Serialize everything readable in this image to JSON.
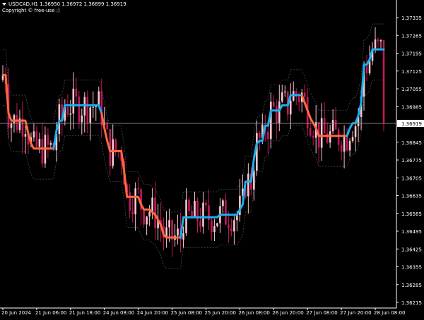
{
  "header": {
    "symbol_line": "USDCAD,H1  1.36950 1.36972 1.36899 1.36919",
    "copyright": "Copyright © free-use :)"
  },
  "chart_data": {
    "type": "candlestick",
    "symbol": "USDCAD",
    "timeframe": "H1",
    "ohlc_header": {
      "open": 1.3695,
      "high": 1.36972,
      "low": 1.36899,
      "close": 1.36919
    },
    "current_price": 1.36919,
    "ylim": [
      1.3618,
      1.374
    ],
    "y_ticks": [
      1.37335,
      1.37265,
      1.37195,
      1.37125,
      1.37055,
      1.36985,
      1.36915,
      1.36845,
      1.36775,
      1.36705,
      1.36635,
      1.36565,
      1.36495,
      1.36425,
      1.36355,
      1.36285,
      1.36215
    ],
    "y_tick_labels": [
      "1.37335",
      "1.37265",
      "1.37195",
      "1.37125",
      "1.37055",
      "1.36985",
      "1.36919",
      "1.36845",
      "1.36775",
      "1.36705",
      "1.36635",
      "1.36565",
      "1.36495",
      "1.36425",
      "1.36355",
      "1.36285",
      "1.36215"
    ],
    "x_tick_labels": [
      "20 Jun 2024",
      "21 Jun 06:00",
      "21 Jun 18:00",
      "24 Jun 08:00",
      "24 Jun 20:00",
      "25 Jun 08:00",
      "25 Jun 20:00",
      "26 Jun 08:00",
      "26 Jun 20:00",
      "27 Jun 08:00",
      "27 Jun 20:00",
      "28 Jun 08:00"
    ],
    "x_tick_index": [
      0,
      12,
      24,
      36,
      48,
      60,
      72,
      84,
      96,
      108,
      120,
      132
    ],
    "bar_count": 136,
    "grid": false,
    "colors": {
      "background": "#000000",
      "axis_text": "#ffffff",
      "bull_candle": "#f7c6cc",
      "bear_candle": "#c2185b",
      "trend_up": "#1ab0f0",
      "trend_down": "#ff6a3d",
      "channel": "#555555",
      "price_line": "#8a8a8a"
    },
    "trend_line": {
      "name": "",
      "segments": [
        {
          "direction": "down",
          "start": 0,
          "end": 18
        },
        {
          "direction": "up",
          "start": 18,
          "end": 35
        },
        {
          "direction": "down",
          "start": 35,
          "end": 63
        },
        {
          "direction": "up",
          "start": 63,
          "end": 106
        },
        {
          "direction": "down",
          "start": 106,
          "end": 122
        },
        {
          "direction": "up",
          "start": 122,
          "end": 135
        }
      ],
      "values": [
        1.3711,
        1.3711,
        1.3696,
        1.3693,
        1.3693,
        1.3693,
        1.3693,
        1.3693,
        1.3693,
        1.3688,
        1.3684,
        1.3682,
        1.3682,
        1.3682,
        1.3682,
        1.3682,
        1.3682,
        1.3682,
        1.3682,
        1.3689,
        1.3693,
        1.3693,
        1.3699,
        1.3699,
        1.3699,
        1.3699,
        1.3699,
        1.3699,
        1.3699,
        1.3699,
        1.3699,
        1.3699,
        1.3699,
        1.3699,
        1.3699,
        1.3696,
        1.369,
        1.3685,
        1.3681,
        1.3681,
        1.3681,
        1.3681,
        1.3681,
        1.3673,
        1.3663,
        1.3663,
        1.3663,
        1.3663,
        1.3663,
        1.366,
        1.3658,
        1.3658,
        1.3658,
        1.3657,
        1.3656,
        1.3654,
        1.3652,
        1.3648,
        1.3647,
        1.3647,
        1.3647,
        1.3647,
        1.3647,
        1.3647,
        1.3655,
        1.3655,
        1.3655,
        1.3655,
        1.3655,
        1.3655,
        1.3655,
        1.3655,
        1.3655,
        1.3655,
        1.3655,
        1.3655,
        1.3655,
        1.3656,
        1.3656,
        1.3656,
        1.3656,
        1.3656,
        1.3656,
        1.3656,
        1.3658,
        1.366,
        1.3669,
        1.3669,
        1.3669,
        1.3678,
        1.3684,
        1.3685,
        1.3685,
        1.3691,
        1.3691,
        1.3697,
        1.3697,
        1.3697,
        1.3697,
        1.3699,
        1.3699,
        1.3699,
        1.3703,
        1.3703,
        1.3703,
        1.3703,
        1.3703,
        1.37,
        1.3697,
        1.3694,
        1.3692,
        1.369,
        1.3687,
        1.3687,
        1.3687,
        1.3687,
        1.3687,
        1.3687,
        1.3687,
        1.3687,
        1.3687,
        1.3687,
        1.3687,
        1.369,
        1.3692,
        1.3692,
        1.3695,
        1.37,
        1.3715,
        1.3715,
        1.3717,
        1.3721,
        1.3721,
        1.3721,
        1.3721,
        1.3721
      ]
    }
  }
}
